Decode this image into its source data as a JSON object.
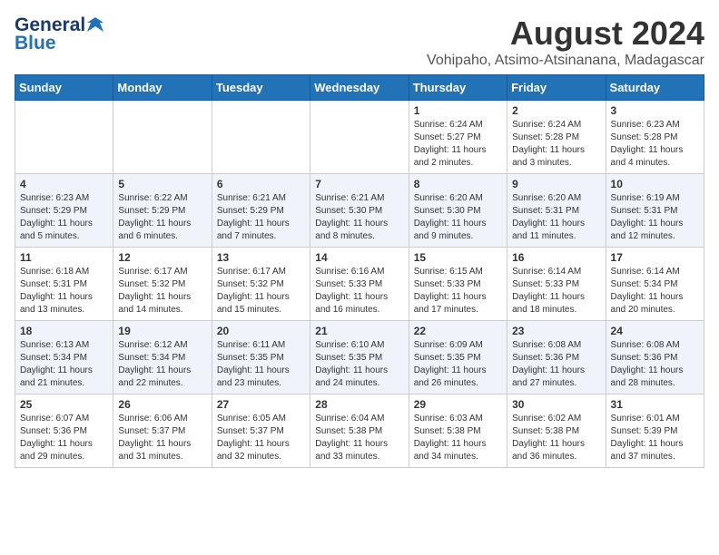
{
  "header": {
    "logo_general": "General",
    "logo_blue": "Blue",
    "title": "August 2024",
    "subtitle": "Vohipaho, Atsimo-Atsinanana, Madagascar"
  },
  "calendar": {
    "weekdays": [
      "Sunday",
      "Monday",
      "Tuesday",
      "Wednesday",
      "Thursday",
      "Friday",
      "Saturday"
    ],
    "weeks": [
      [
        {
          "day": "",
          "info": ""
        },
        {
          "day": "",
          "info": ""
        },
        {
          "day": "",
          "info": ""
        },
        {
          "day": "",
          "info": ""
        },
        {
          "day": "1",
          "info": "Sunrise: 6:24 AM\nSunset: 5:27 PM\nDaylight: 11 hours\nand 2 minutes."
        },
        {
          "day": "2",
          "info": "Sunrise: 6:24 AM\nSunset: 5:28 PM\nDaylight: 11 hours\nand 3 minutes."
        },
        {
          "day": "3",
          "info": "Sunrise: 6:23 AM\nSunset: 5:28 PM\nDaylight: 11 hours\nand 4 minutes."
        }
      ],
      [
        {
          "day": "4",
          "info": "Sunrise: 6:23 AM\nSunset: 5:29 PM\nDaylight: 11 hours\nand 5 minutes."
        },
        {
          "day": "5",
          "info": "Sunrise: 6:22 AM\nSunset: 5:29 PM\nDaylight: 11 hours\nand 6 minutes."
        },
        {
          "day": "6",
          "info": "Sunrise: 6:21 AM\nSunset: 5:29 PM\nDaylight: 11 hours\nand 7 minutes."
        },
        {
          "day": "7",
          "info": "Sunrise: 6:21 AM\nSunset: 5:30 PM\nDaylight: 11 hours\nand 8 minutes."
        },
        {
          "day": "8",
          "info": "Sunrise: 6:20 AM\nSunset: 5:30 PM\nDaylight: 11 hours\nand 9 minutes."
        },
        {
          "day": "9",
          "info": "Sunrise: 6:20 AM\nSunset: 5:31 PM\nDaylight: 11 hours\nand 11 minutes."
        },
        {
          "day": "10",
          "info": "Sunrise: 6:19 AM\nSunset: 5:31 PM\nDaylight: 11 hours\nand 12 minutes."
        }
      ],
      [
        {
          "day": "11",
          "info": "Sunrise: 6:18 AM\nSunset: 5:31 PM\nDaylight: 11 hours\nand 13 minutes."
        },
        {
          "day": "12",
          "info": "Sunrise: 6:17 AM\nSunset: 5:32 PM\nDaylight: 11 hours\nand 14 minutes."
        },
        {
          "day": "13",
          "info": "Sunrise: 6:17 AM\nSunset: 5:32 PM\nDaylight: 11 hours\nand 15 minutes."
        },
        {
          "day": "14",
          "info": "Sunrise: 6:16 AM\nSunset: 5:33 PM\nDaylight: 11 hours\nand 16 minutes."
        },
        {
          "day": "15",
          "info": "Sunrise: 6:15 AM\nSunset: 5:33 PM\nDaylight: 11 hours\nand 17 minutes."
        },
        {
          "day": "16",
          "info": "Sunrise: 6:14 AM\nSunset: 5:33 PM\nDaylight: 11 hours\nand 18 minutes."
        },
        {
          "day": "17",
          "info": "Sunrise: 6:14 AM\nSunset: 5:34 PM\nDaylight: 11 hours\nand 20 minutes."
        }
      ],
      [
        {
          "day": "18",
          "info": "Sunrise: 6:13 AM\nSunset: 5:34 PM\nDaylight: 11 hours\nand 21 minutes."
        },
        {
          "day": "19",
          "info": "Sunrise: 6:12 AM\nSunset: 5:34 PM\nDaylight: 11 hours\nand 22 minutes."
        },
        {
          "day": "20",
          "info": "Sunrise: 6:11 AM\nSunset: 5:35 PM\nDaylight: 11 hours\nand 23 minutes."
        },
        {
          "day": "21",
          "info": "Sunrise: 6:10 AM\nSunset: 5:35 PM\nDaylight: 11 hours\nand 24 minutes."
        },
        {
          "day": "22",
          "info": "Sunrise: 6:09 AM\nSunset: 5:35 PM\nDaylight: 11 hours\nand 26 minutes."
        },
        {
          "day": "23",
          "info": "Sunrise: 6:08 AM\nSunset: 5:36 PM\nDaylight: 11 hours\nand 27 minutes."
        },
        {
          "day": "24",
          "info": "Sunrise: 6:08 AM\nSunset: 5:36 PM\nDaylight: 11 hours\nand 28 minutes."
        }
      ],
      [
        {
          "day": "25",
          "info": "Sunrise: 6:07 AM\nSunset: 5:36 PM\nDaylight: 11 hours\nand 29 minutes."
        },
        {
          "day": "26",
          "info": "Sunrise: 6:06 AM\nSunset: 5:37 PM\nDaylight: 11 hours\nand 31 minutes."
        },
        {
          "day": "27",
          "info": "Sunrise: 6:05 AM\nSunset: 5:37 PM\nDaylight: 11 hours\nand 32 minutes."
        },
        {
          "day": "28",
          "info": "Sunrise: 6:04 AM\nSunset: 5:38 PM\nDaylight: 11 hours\nand 33 minutes."
        },
        {
          "day": "29",
          "info": "Sunrise: 6:03 AM\nSunset: 5:38 PM\nDaylight: 11 hours\nand 34 minutes."
        },
        {
          "day": "30",
          "info": "Sunrise: 6:02 AM\nSunset: 5:38 PM\nDaylight: 11 hours\nand 36 minutes."
        },
        {
          "day": "31",
          "info": "Sunrise: 6:01 AM\nSunset: 5:39 PM\nDaylight: 11 hours\nand 37 minutes."
        }
      ]
    ]
  }
}
